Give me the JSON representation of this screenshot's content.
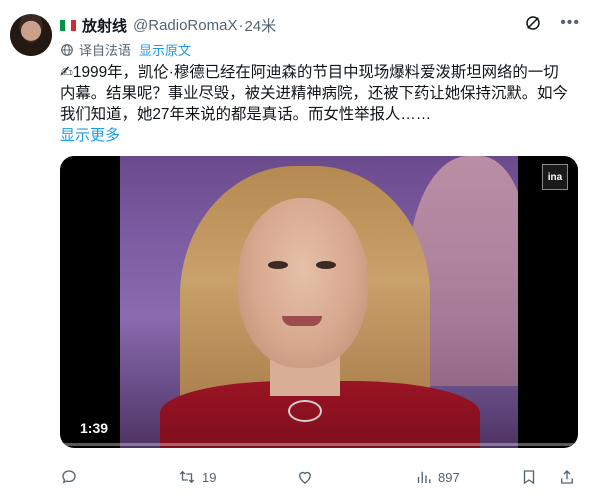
{
  "header": {
    "name": "放射线",
    "handle": "@RadioRomaX",
    "separator": "·",
    "time": "24米"
  },
  "translate": {
    "label": "译自法语",
    "link": "显示原文"
  },
  "post": {
    "text": "✍1999年，凯伦·穆德已经在阿迪森的节目中现场爆料爱泼斯坦网络的一切内幕。结果呢？事业尽毁，被关进精神病院，还被下药让她保持沉默。如今我们知道，她27年来说的都是真话。而女性举报人……",
    "show_more": "显示更多"
  },
  "video": {
    "duration": "1:39",
    "logo": "ina",
    "progress": 0.0
  },
  "actions": {
    "retweets": "19",
    "views": "897"
  },
  "colors": {
    "accent": "#1d9bf0",
    "muted": "#536471",
    "text": "#0f1419"
  }
}
